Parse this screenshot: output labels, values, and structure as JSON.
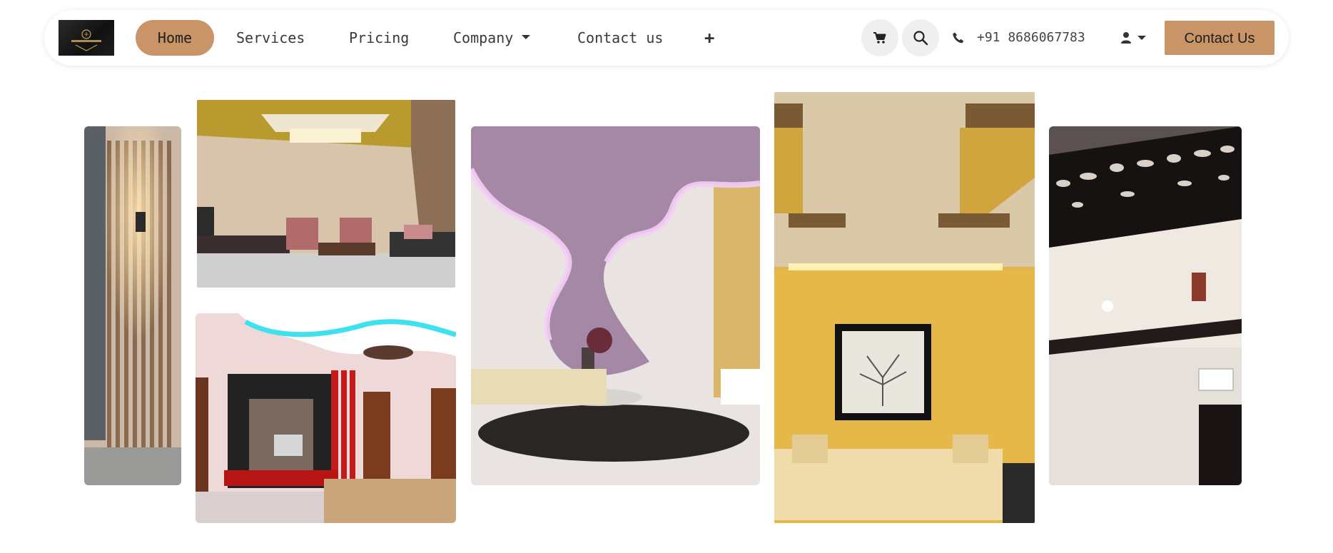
{
  "navbar": {
    "logo_icon": "brand-logo",
    "home_label": "Home",
    "services_label": "Services",
    "pricing_label": "Pricing",
    "company_label": "Company",
    "contact_label": "Contact us",
    "plus_label": "+",
    "cart_icon": "cart-icon",
    "search_icon": "search-icon",
    "phone_icon": "phone-icon",
    "phone_number": "+91 8686067783",
    "user_icon": "user-icon",
    "cta_label": "Contact Us"
  },
  "colors": {
    "accent": "#c99467",
    "icon_bg": "#efefef",
    "text": "#3a3a3a"
  },
  "gallery": {
    "images": [
      {
        "name": "wood-slat-wall-panel"
      },
      {
        "name": "living-room-gold-ceiling"
      },
      {
        "name": "tv-unit-bedroom-ceiling"
      },
      {
        "name": "purple-wave-ceiling-lounge"
      },
      {
        "name": "yellow-sofa-framed-art"
      },
      {
        "name": "jaali-cutwork-ceiling"
      }
    ]
  }
}
